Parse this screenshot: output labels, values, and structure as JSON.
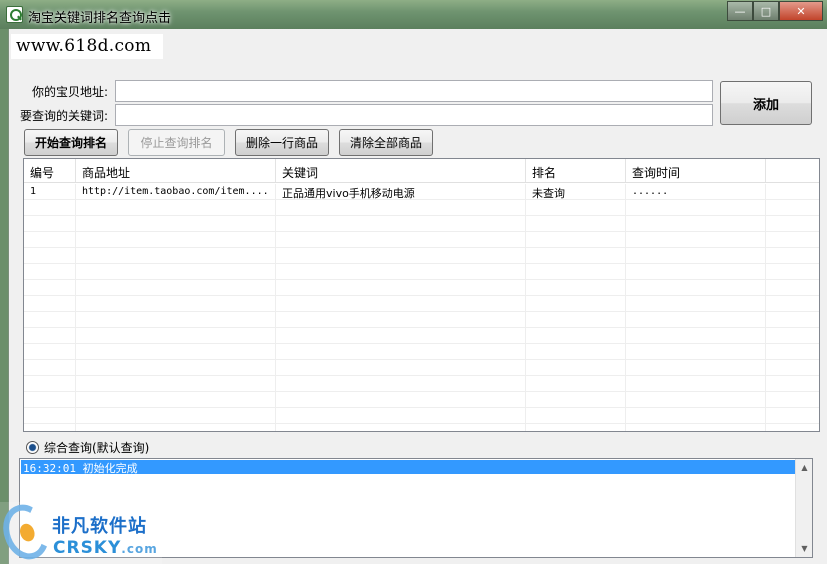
{
  "window": {
    "title": "淘宝关键词排名查询点击",
    "minimize_glyph": "—",
    "maximize_glyph": "□",
    "close_glyph": "✕"
  },
  "site_logo": "www.618d.com",
  "form": {
    "url_label": "你的宝贝地址:",
    "url_value": "",
    "keyword_label": "要查询的关键词:",
    "keyword_value": "",
    "add_button": "添加"
  },
  "toolbar": {
    "start_query": "开始查询排名",
    "stop_query": "停止查询排名",
    "delete_row": "删除一行商品",
    "clear_all": "清除全部商品"
  },
  "table": {
    "columns": [
      "编号",
      "商品地址",
      "关键词",
      "排名",
      "查询时间"
    ],
    "rows": [
      [
        "1",
        "http://item.taobao.com/item....",
        "正品通用vivo手机移动电源",
        "未查询",
        "......"
      ]
    ]
  },
  "query_mode": {
    "label": "综合查询(默认查询)",
    "selected": true
  },
  "log": {
    "lines": [
      "16:32:01 初始化完成"
    ]
  },
  "watermark": {
    "cn": "非凡软件站",
    "en": "CRSKY",
    "en_suffix": ".com"
  },
  "icons": {
    "app": "search-magnifier-icon",
    "scroll_up": "▲",
    "scroll_down": "▼"
  }
}
